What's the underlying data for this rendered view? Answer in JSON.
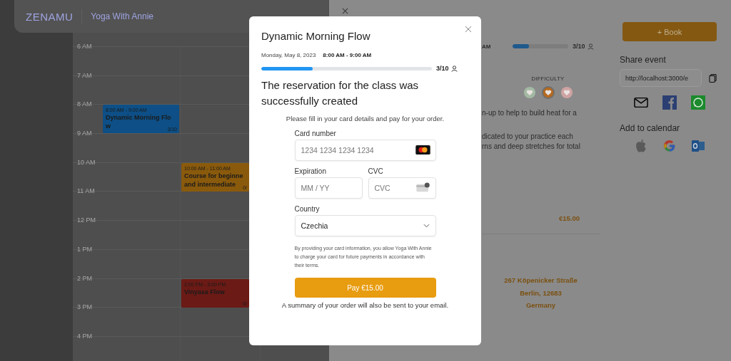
{
  "header": {
    "logo": "ZENAMU",
    "studio": "Yoga With Annie"
  },
  "calendar": {
    "hours": [
      {
        "label": "6 AM"
      },
      {
        "label": "7 AM"
      },
      {
        "label": "8 AM",
        "events": [
          {
            "kind": "day1",
            "time": "8:00 AM - 9:00 AM",
            "lines": [
              "Dynamic Morning Flo",
              "w"
            ],
            "capacity": "3/10",
            "color": "#0d4f86"
          }
        ]
      },
      {
        "label": "9 AM"
      },
      {
        "label": "10 AM",
        "events": [
          {
            "kind": "day2",
            "time": "10:00 AM - 11:00 AM",
            "lines": [
              "Course for beginne",
              "and intermediate"
            ],
            "capacity": "0/",
            "color": "#8a5a0c"
          }
        ]
      },
      {
        "label": "11 AM"
      },
      {
        "label": "12 PM"
      },
      {
        "label": "1 PM"
      },
      {
        "label": "2 PM",
        "events": [
          {
            "kind": "day2",
            "time": "2:00 PM - 3:00 PM",
            "lines": [
              "Vinyasa Flow"
            ],
            "capacity": "0/",
            "color": "#6b1a15"
          }
        ]
      },
      {
        "label": "3 PM"
      },
      {
        "label": "4 PM"
      }
    ]
  },
  "drawer": {
    "time_fragment": "AM",
    "occupancy": {
      "level": 0.3,
      "count": "3/10"
    },
    "difficulty": {
      "label": "DIFFICULTY",
      "options": [
        {
          "color": "#a3b9a3",
          "selected": false
        },
        {
          "color": "#b5691f",
          "selected": true
        },
        {
          "color": "#cfa3a3",
          "selected": false
        }
      ]
    },
    "description": [
      [
        "n-up to help to build heat for a"
      ],
      [
        "dicated to your practice each",
        "rns and deep stretches for total"
      ]
    ],
    "price": "€15.00",
    "address": [
      "267 Köpenicker Straße",
      "Berlin, 12683",
      "Germany"
    ],
    "book_button": "+ Book",
    "share_title": "Share event",
    "share_url": "http://localhost:3000/e",
    "calendar_title": "Add to calendar"
  },
  "modal": {
    "title": "Dynamic Morning Flow",
    "date": "Monday, May 8, 2023",
    "time": "8:00 AM - 9:00 AM",
    "occupancy": {
      "level": 0.3,
      "count": "3/10"
    },
    "heading": "The reservation for the class was successfully created",
    "instruction": "Please fill in your card details and pay for your order.",
    "card_number": {
      "label": "Card number",
      "placeholder": "1234 1234 1234 1234"
    },
    "expiration": {
      "label": "Expiration",
      "placeholder": "MM / YY"
    },
    "cvc": {
      "label": "CVC",
      "placeholder": "CVC"
    },
    "country": {
      "label": "Country",
      "value": "Czechia"
    },
    "consent": "By providing your card information, you allow Yoga With Annie to charge your card for future payments in accordance with their terms.",
    "pay_button": "Pay €15.00",
    "summary": "A summary of your order will also be sent to your email."
  }
}
